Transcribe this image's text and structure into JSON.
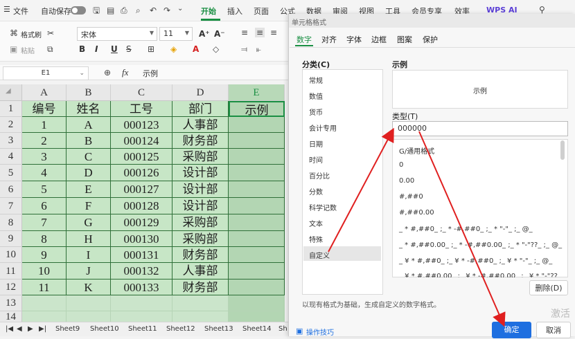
{
  "menubar": {
    "menu_icon": "☰",
    "file": "文件",
    "autosave": "自动保存",
    "tabs": [
      "开始",
      "插入",
      "页面",
      "公式",
      "数据",
      "审阅",
      "视图",
      "工具",
      "会员专享",
      "效率"
    ],
    "wps_ai": "WPS AI"
  },
  "ribbon": {
    "format_brush": "格式刷",
    "paste": "粘贴",
    "font_name": "宋体",
    "font_size": "11",
    "bold": "B",
    "italic": "I",
    "underline": "U",
    "font_color_glyph": "A"
  },
  "formula_bar": {
    "cell_ref": "E1",
    "fx": "fx",
    "content": "示例"
  },
  "sheet": {
    "columns": [
      "A",
      "B",
      "C",
      "D",
      "E"
    ],
    "rows": [
      [
        "编号",
        "姓名",
        "工号",
        "部门",
        "示例"
      ],
      [
        "1",
        "A",
        "000123",
        "人事部",
        ""
      ],
      [
        "2",
        "B",
        "000124",
        "财务部",
        ""
      ],
      [
        "3",
        "C",
        "000125",
        "采购部",
        ""
      ],
      [
        "4",
        "D",
        "000126",
        "设计部",
        ""
      ],
      [
        "5",
        "E",
        "000127",
        "设计部",
        ""
      ],
      [
        "6",
        "F",
        "000128",
        "设计部",
        ""
      ],
      [
        "7",
        "G",
        "000129",
        "采购部",
        ""
      ],
      [
        "8",
        "H",
        "000130",
        "采购部",
        ""
      ],
      [
        "9",
        "I",
        "000131",
        "财务部",
        ""
      ],
      [
        "10",
        "J",
        "000132",
        "人事部",
        ""
      ],
      [
        "11",
        "K",
        "000133",
        "财务部",
        ""
      ],
      [
        "",
        "",
        "",
        "",
        ""
      ],
      [
        "",
        "",
        "",
        "",
        ""
      ]
    ],
    "row_numbers": [
      "1",
      "2",
      "3",
      "4",
      "5",
      "6",
      "7",
      "8",
      "9",
      "10",
      "11",
      "12",
      "13",
      "14"
    ],
    "tabs": [
      "Sheet9",
      "Sheet10",
      "Sheet11",
      "Sheet12",
      "Sheet13",
      "Sheet14",
      "Sh"
    ]
  },
  "dialog": {
    "title": "单元格格式",
    "tabs": [
      "数字",
      "对齐",
      "字体",
      "边框",
      "图案",
      "保护"
    ],
    "active_tab": "数字",
    "category_label": "分类(C)",
    "categories": [
      "常规",
      "数值",
      "货币",
      "会计专用",
      "日期",
      "时间",
      "百分比",
      "分数",
      "科学记数",
      "文本",
      "特殊",
      "自定义"
    ],
    "selected_category": "自定义",
    "sample_label": "示例",
    "sample_value": "示例",
    "type_label": "类型(T)",
    "type_value": "000000",
    "formats": [
      "G/通用格式",
      "0",
      "0.00",
      "#,##0",
      "#,##0.00",
      "_ * #,##0_ ;_ * -#,##0_ ;_ * \"-\"_ ;_ @_",
      "_ * #,##0.00_ ;_ * -#,##0.00_ ;_ * \"-\"??_ ;_ @_",
      "_ ¥ * #,##0_ ;_ ¥ * -#,##0_ ;_ ¥ * \"-\"_ ;_ @_",
      "_ ¥ * #,##0.00_ ;_ ¥ * -#,##0.00_ ;_ ¥ * \"-\"??"
    ],
    "delete_button": "删除(D)",
    "hint": "以现有格式为基础，生成自定义的数字格式。",
    "tips": "操作技巧",
    "ok": "确定",
    "cancel": "取消"
  },
  "watermark": "激活",
  "colors": {
    "accent_green": "#1a8f43",
    "cell_fill": "#c7e6c6",
    "arrow_red": "#e02020",
    "ok_blue": "#1e6fe0"
  }
}
